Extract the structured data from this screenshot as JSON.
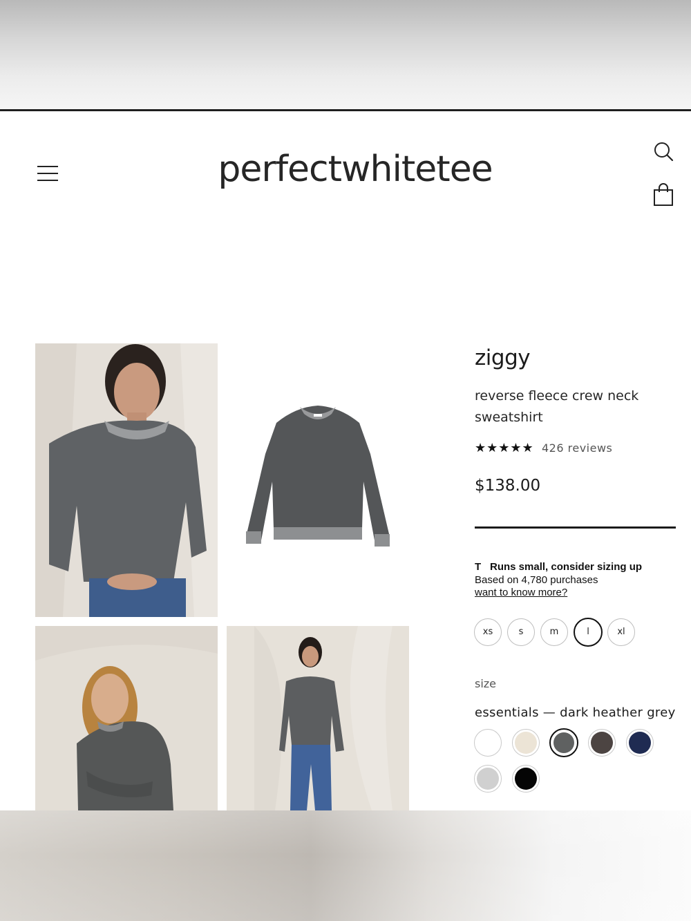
{
  "header": {
    "logo": "perfectwhitetee",
    "menu_icon": "hamburger-menu-icon",
    "search_icon": "search-icon",
    "cart_icon": "shopping-bag-icon"
  },
  "gallery": [
    {
      "label": "model wearing sweatshirt, front"
    },
    {
      "label": "sweatshirt flat lay"
    },
    {
      "label": "model wearing sweatshirt, smiling"
    },
    {
      "label": "model wearing sweatshirt, full body"
    }
  ],
  "product": {
    "name": "ziggy",
    "subtitle": "reverse fleece crew neck sweatshirt",
    "stars": "★★★★★",
    "rating": 5,
    "reviews": "426 reviews",
    "price": "$138.00"
  },
  "fit": {
    "logo": "T",
    "title": "Runs small, consider sizing up",
    "based_on": "Based on 4,780 purchases",
    "link": "want to know more?"
  },
  "sizes": {
    "options": [
      "xs",
      "s",
      "m",
      "l",
      "xl"
    ],
    "selected": "l",
    "label": "size"
  },
  "colors": {
    "label": "essentials — dark heather grey",
    "selected": "dark heather grey",
    "swatches": [
      {
        "name": "white",
        "hex": "#ffffff"
      },
      {
        "name": "natural",
        "hex": "#ece4d6"
      },
      {
        "name": "dark heather grey",
        "hex": "#5f6161"
      },
      {
        "name": "brown",
        "hex": "#4c4442"
      },
      {
        "name": "navy",
        "hex": "#1f2b52"
      },
      {
        "name": "heather grey",
        "hex": "#d0d0d0"
      },
      {
        "name": "black",
        "hex": "#050505"
      }
    ]
  }
}
